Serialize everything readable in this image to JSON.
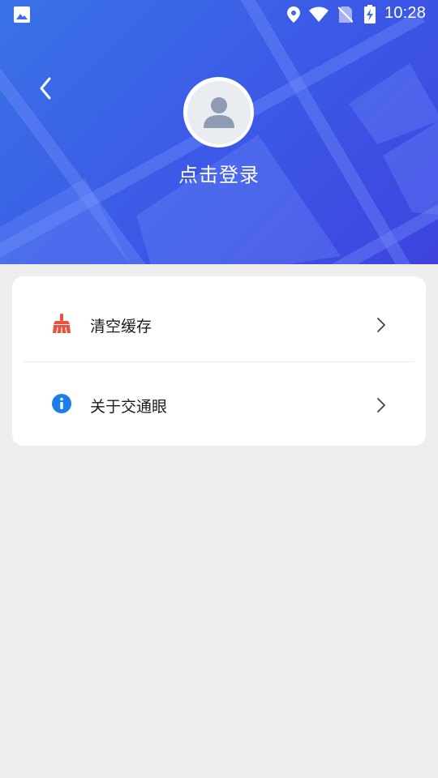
{
  "status_bar": {
    "time": "10:28",
    "icons": [
      "photo-icon",
      "location-icon",
      "wifi-icon",
      "no-sim-icon",
      "battery-charging-icon"
    ]
  },
  "header": {
    "back_icon": "chevron-left-icon",
    "avatar_icon": "user-icon",
    "login_label": "点击登录",
    "colors": {
      "gradient_start": "#3a72e6",
      "gradient_end": "#3f43e0"
    }
  },
  "menu": {
    "items": [
      {
        "label": "清空缓存",
        "icon": "broom-icon",
        "icon_color": "#e9533f"
      },
      {
        "label": "关于交通眼",
        "icon": "info-icon",
        "icon_color": "#1f7de8"
      }
    ],
    "arrow_icon": "chevron-right-icon"
  }
}
